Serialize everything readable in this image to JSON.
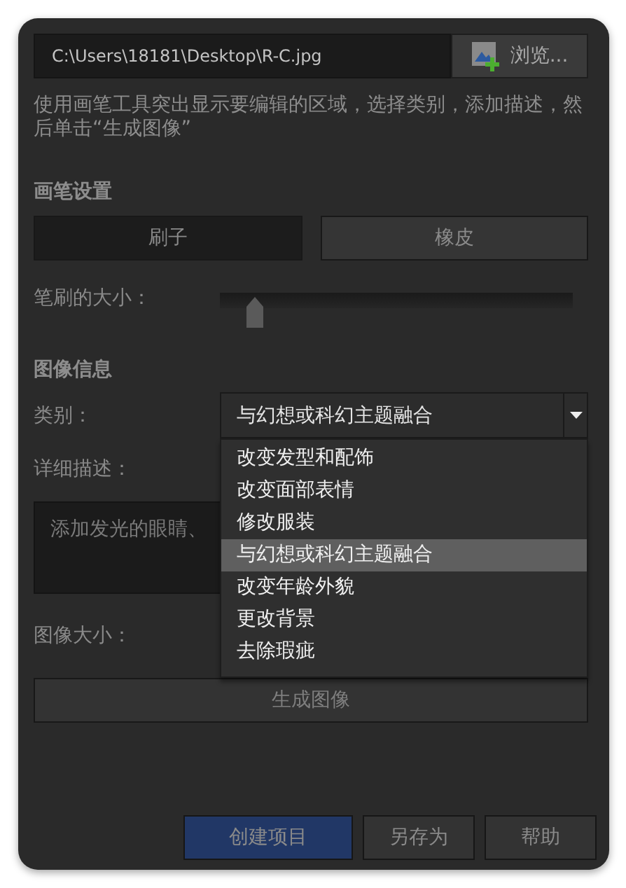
{
  "path_field": {
    "value": "C:\\Users\\18181\\Desktop\\R-C.jpg"
  },
  "browse_button": {
    "label": "浏览..."
  },
  "instructions": "使用画笔工具突出显示要编辑的区域，选择类别，添加描述，然后单击“生成图像”",
  "brush_settings": {
    "heading": "画笔设置",
    "tools": [
      {
        "label": "刷子",
        "selected": true
      },
      {
        "label": "橡皮",
        "selected": false
      }
    ],
    "size_label": "笔刷的大小：",
    "size_slider": {
      "level": 0.1
    }
  },
  "image_info": {
    "heading": "图像信息",
    "category_label": "类别：",
    "category": {
      "value": "与幻想或科幻主题融合",
      "expanded": true,
      "options": [
        {
          "label": "改变发型和配饰",
          "selected": false
        },
        {
          "label": "改变面部表情",
          "selected": false
        },
        {
          "label": "修改服装",
          "selected": false
        },
        {
          "label": "与幻想或科幻主题融合",
          "selected": true
        },
        {
          "label": "改变年龄外貌",
          "selected": false
        },
        {
          "label": "更改背景",
          "selected": false
        },
        {
          "label": "去除瑕疵",
          "selected": false
        }
      ]
    },
    "detail_label": "详细描述：",
    "detail_field": {
      "placeholder": "添加发光的眼睛、"
    },
    "size_label": "图像大小："
  },
  "generate_button": {
    "label": "生成图像"
  },
  "footer_buttons": [
    {
      "label": "创建项目",
      "kind": "primary"
    },
    {
      "label": "另存为",
      "kind": "normal"
    },
    {
      "label": "帮助",
      "kind": "normal"
    }
  ]
}
